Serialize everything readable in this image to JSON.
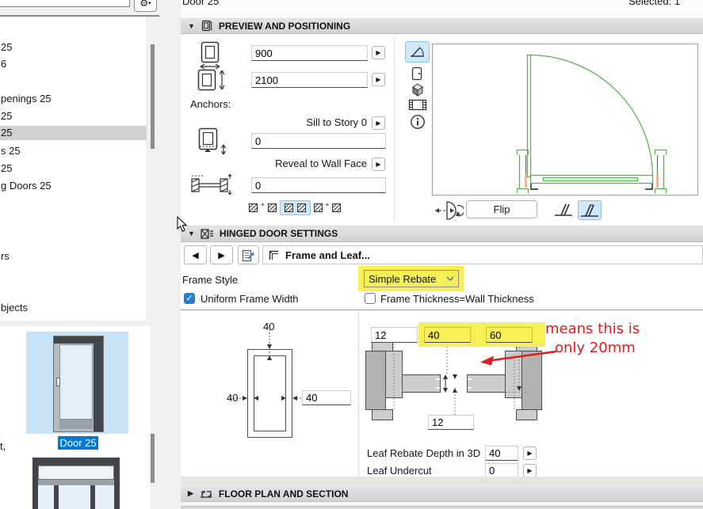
{
  "window": {
    "title": "Door 25",
    "selected_label": "Selected: 1"
  },
  "sidebar": {
    "search_value": "",
    "items": [
      {
        "label": "25"
      },
      {
        "label": "6"
      },
      {
        "label": "penings 25"
      },
      {
        "label": "25"
      },
      {
        "label": "25"
      },
      {
        "label": "s 25"
      },
      {
        "label": "25"
      },
      {
        "label": "g Doors 25"
      },
      {
        "label": "rs"
      },
      {
        "label": "bjects"
      }
    ],
    "partial_text": "t,",
    "thumbnail_label": "Door 25"
  },
  "preview": {
    "header": "PREVIEW AND POSITIONING",
    "width_value": "900",
    "height_value": "2100",
    "anchors_label": "Anchors:",
    "sill_label": "Sill to Story 0",
    "sill_value": "0",
    "reveal_label": "Reveal to Wall Face",
    "reveal_value": "0",
    "flip_label": "Flip"
  },
  "hinged": {
    "header": "HINGED DOOR SETTINGS",
    "tab_label": "Frame and Leaf...",
    "frame_style_label": "Frame Style",
    "frame_style_value": "Simple Rebate",
    "uniform_label": "Uniform Frame Width",
    "thickness_label": "Frame Thickness=Wall Thickness",
    "front_top_dim": "40",
    "front_left_dim": "40",
    "front_right_value": "40",
    "sec_left_value": "12",
    "sec_mid_value": "40",
    "sec_right_value": "60",
    "sec_bottom_value": "12",
    "annotation_line1": "means this is",
    "annotation_line2": "only 20mm",
    "leaf_rebate_label": "Leaf Rebate Depth in 3D",
    "leaf_rebate_value": "40",
    "leaf_undercut_label": "Leaf Undercut",
    "leaf_undercut_value": "0"
  },
  "floorplan": {
    "header": "FLOOR PLAN AND SECTION"
  },
  "colors": {
    "highlight_yellow": "#f6ef55",
    "annotation_red": "#e01b1b",
    "selection_blue_bg": "#cfe8fc",
    "selection_blue_border": "#86c3ef",
    "accent_blue": "#0078d7",
    "drawing_green": "#55b54e",
    "list_selection_gray": "#d0d0d0"
  }
}
